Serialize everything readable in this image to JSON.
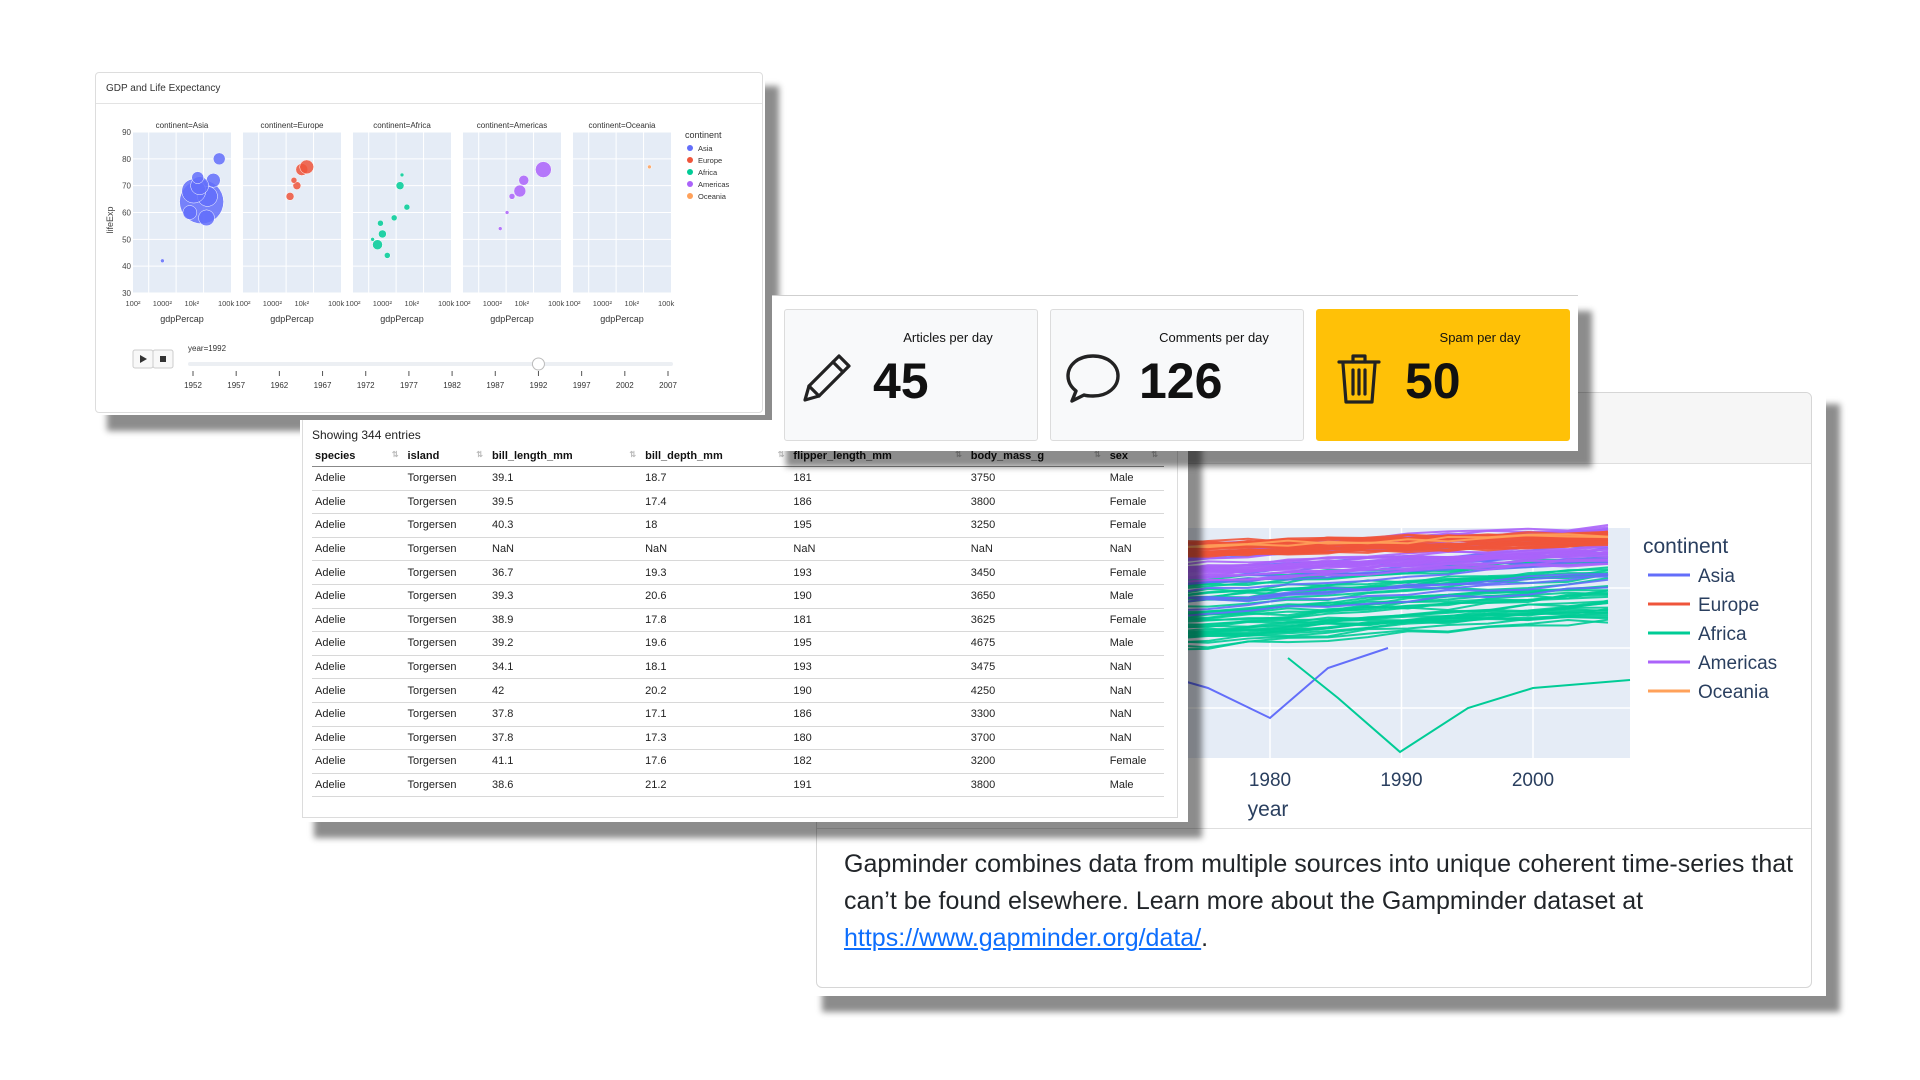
{
  "scatter": {
    "title": "GDP and Life Expectancy",
    "facets": [
      "continent=Asia",
      "continent=Europe",
      "continent=Africa",
      "continent=Americas",
      "continent=Oceania"
    ],
    "ylabel": "lifeExp",
    "xlabel": "gdpPercap",
    "yticks": [
      "90",
      "80",
      "70",
      "60",
      "50",
      "40",
      "30"
    ],
    "xticks": [
      "100²",
      "1000²",
      "10k²",
      "100k"
    ],
    "legend_title": "continent",
    "legend": [
      "Asia",
      "Europe",
      "Africa",
      "Americas",
      "Oceania"
    ],
    "slider_label": "year=1992",
    "play_icon": "play-icon",
    "stop_icon": "stop-icon",
    "years": [
      "1952",
      "1957",
      "1962",
      "1967",
      "1972",
      "1977",
      "1982",
      "1987",
      "1992",
      "1997",
      "2002",
      "2007"
    ],
    "current_year": "1992"
  },
  "colors": {
    "Asia": "#636efa",
    "Europe": "#ef553b",
    "Africa": "#00cc96",
    "Americas": "#ab63fa",
    "Oceania": "#ffa15a",
    "plot_bg": "#e5ecf6",
    "spam_bg": "#ffc107"
  },
  "kpis": [
    {
      "label": "Articles per day",
      "value": "45",
      "icon": "pencil-icon"
    },
    {
      "label": "Comments per day",
      "value": "126",
      "icon": "speech-bubble-icon"
    },
    {
      "label": "Spam per day",
      "value": "50",
      "icon": "trash-icon"
    }
  ],
  "table": {
    "showing": "Showing 344 entries",
    "columns": [
      "species",
      "island",
      "bill_length_mm",
      "bill_depth_mm",
      "flipper_length_mm",
      "body_mass_g",
      "sex"
    ],
    "rows": [
      [
        "Adelie",
        "Torgersen",
        "39.1",
        "18.7",
        "181",
        "3750",
        "Male"
      ],
      [
        "Adelie",
        "Torgersen",
        "39.5",
        "17.4",
        "186",
        "3800",
        "Female"
      ],
      [
        "Adelie",
        "Torgersen",
        "40.3",
        "18",
        "195",
        "3250",
        "Female"
      ],
      [
        "Adelie",
        "Torgersen",
        "NaN",
        "NaN",
        "NaN",
        "NaN",
        "NaN"
      ],
      [
        "Adelie",
        "Torgersen",
        "36.7",
        "19.3",
        "193",
        "3450",
        "Female"
      ],
      [
        "Adelie",
        "Torgersen",
        "39.3",
        "20.6",
        "190",
        "3650",
        "Male"
      ],
      [
        "Adelie",
        "Torgersen",
        "38.9",
        "17.8",
        "181",
        "3625",
        "Female"
      ],
      [
        "Adelie",
        "Torgersen",
        "39.2",
        "19.6",
        "195",
        "4675",
        "Male"
      ],
      [
        "Adelie",
        "Torgersen",
        "34.1",
        "18.1",
        "193",
        "3475",
        "NaN"
      ],
      [
        "Adelie",
        "Torgersen",
        "42",
        "20.2",
        "190",
        "4250",
        "NaN"
      ],
      [
        "Adelie",
        "Torgersen",
        "37.8",
        "17.1",
        "186",
        "3300",
        "NaN"
      ],
      [
        "Adelie",
        "Torgersen",
        "37.8",
        "17.3",
        "180",
        "3700",
        "NaN"
      ],
      [
        "Adelie",
        "Torgersen",
        "41.1",
        "17.6",
        "182",
        "3200",
        "Female"
      ],
      [
        "Adelie",
        "Torgersen",
        "38.6",
        "21.2",
        "191",
        "3800",
        "Male"
      ]
    ]
  },
  "lines": {
    "legend_title": "continent",
    "legend": [
      "Asia",
      "Europe",
      "Africa",
      "Americas",
      "Oceania"
    ],
    "xticks": [
      "1980",
      "1990",
      "2000"
    ],
    "xlabel": "year",
    "paragraph": "Gapminder combines data from multiple sources into unique coherent time-series that can’t be found elsewhere. Learn more about the Gampminder dataset at ",
    "link": "https://www.gapminder.org/data/",
    "after_link": "."
  }
}
